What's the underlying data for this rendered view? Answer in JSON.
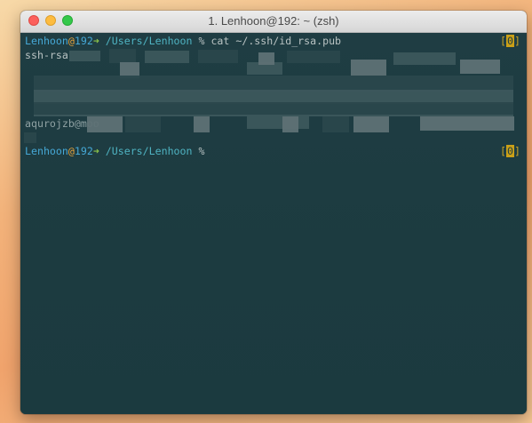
{
  "window": {
    "title": "1. Lenhoon@192: ~ (zsh)"
  },
  "prompt1": {
    "user": "Lenhoon",
    "at": "@",
    "host": "192",
    "arrow": "➜",
    "path": " /Users/Lenhoon",
    "symbol": " %",
    "command": " cat ~/.ssh/id_rsa.pub",
    "status_open": "[",
    "status_num": "0",
    "status_close": "]"
  },
  "output": {
    "key_prefix": "ssh-rsa",
    "key_tail_fragment": "aqurojzb@moo"
  },
  "prompt2": {
    "user": "Lenhoon",
    "at": "@",
    "host": "192",
    "arrow": "➜",
    "path": " /Users/Lenhoon",
    "symbol": " %",
    "status_open": "[",
    "status_num": "0",
    "status_close": "]"
  },
  "colors": {
    "terminal_bg": "#1f3d43",
    "user": "#46a8d6",
    "at": "#e8a43c",
    "arrow": "#8bc34a",
    "path": "#4fb3c2",
    "status": "#c9a227"
  }
}
